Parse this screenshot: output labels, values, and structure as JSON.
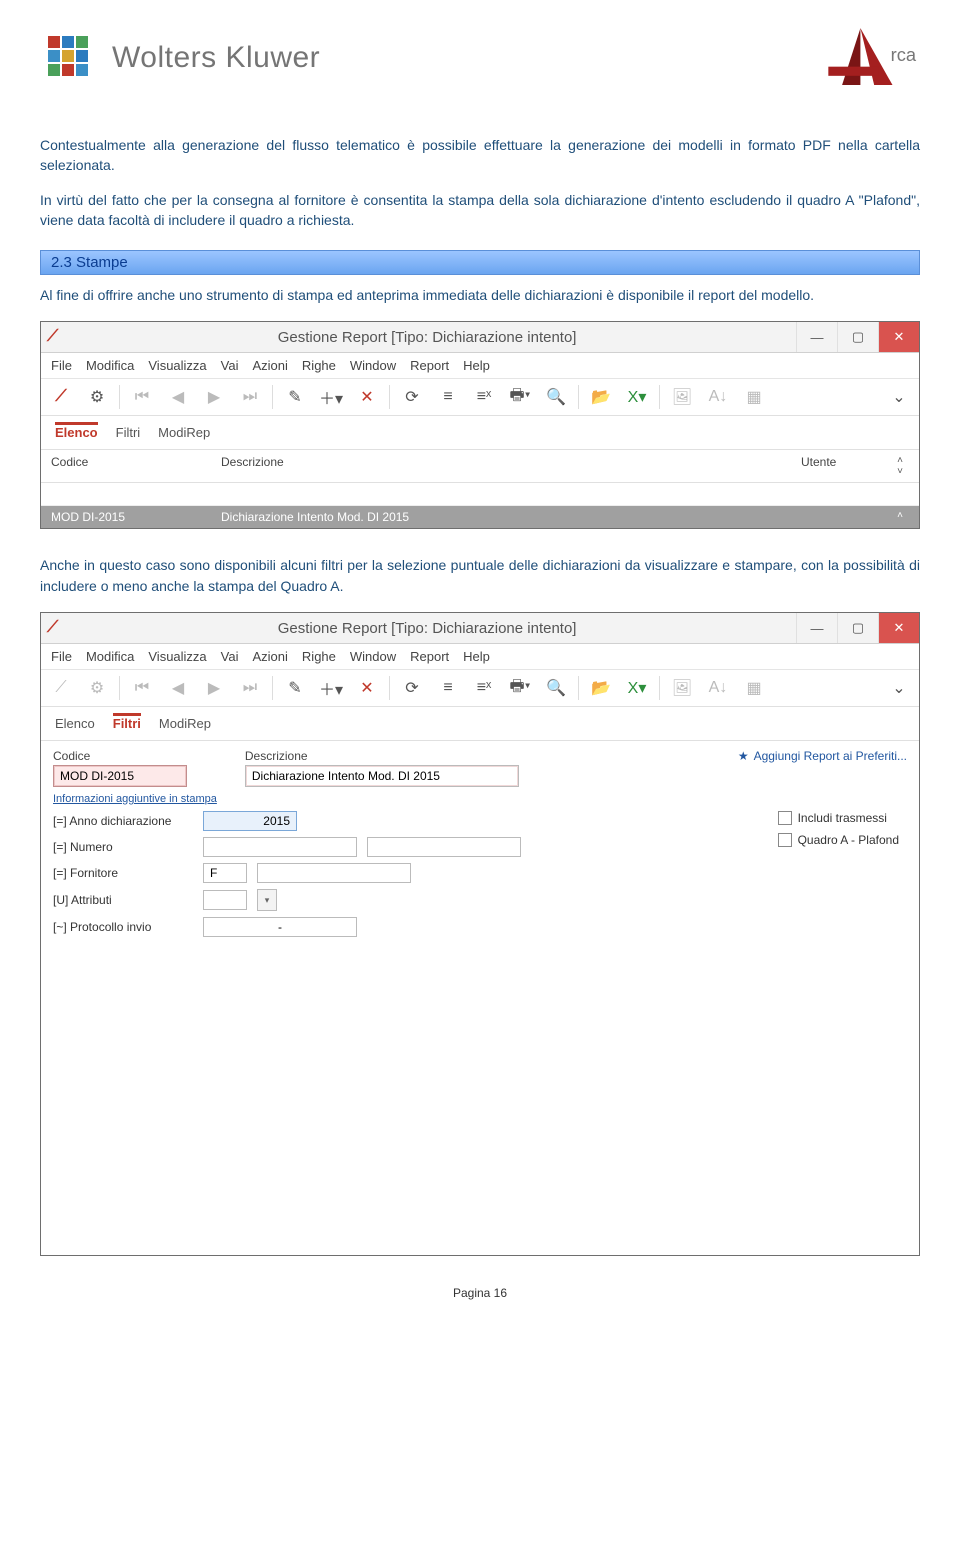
{
  "header": {
    "brand": "Wolters Kluwer",
    "secondary_brand": "rca"
  },
  "paragraphs": {
    "p1": "Contestualmente alla generazione del flusso telematico è possibile effettuare la generazione dei modelli in formato PDF nella cartella selezionata.",
    "p2": "In virtù del fatto che per la consegna al fornitore è consentita la stampa della sola dichiarazione d'intento escludendo il quadro A \"Plafond\", viene data facoltà di includere il quadro a richiesta.",
    "section_heading": "2.3   Stampe",
    "p3": "Al fine di offrire anche uno strumento di stampa ed anteprima immediata delle dichiarazioni è disponibile il report del modello.",
    "p4": "Anche in questo caso sono disponibili alcuni filtri per la selezione puntuale delle dichiarazioni da visualizzare e stampare, con la possibilità di includere o meno anche la stampa del Quadro A."
  },
  "window1": {
    "title": "Gestione Report [Tipo: Dichiarazione intento]",
    "menu": [
      "File",
      "Modifica",
      "Visualizza",
      "Vai",
      "Azioni",
      "Righe",
      "Window",
      "Report",
      "Help"
    ],
    "tabs": [
      "Elenco",
      "Filtri",
      "ModiRep"
    ],
    "active_tab": 0,
    "columns": {
      "codice": "Codice",
      "descrizione": "Descrizione",
      "utente": "Utente"
    },
    "row": {
      "codice": "MOD DI-2015",
      "descrizione": "Dichiarazione Intento Mod. DI 2015"
    }
  },
  "window2": {
    "title": "Gestione Report [Tipo: Dichiarazione intento]",
    "menu": [
      "File",
      "Modifica",
      "Visualizza",
      "Vai",
      "Azioni",
      "Righe",
      "Window",
      "Report",
      "Help"
    ],
    "tabs": [
      "Elenco",
      "Filtri",
      "ModiRep"
    ],
    "active_tab": 1,
    "fields": {
      "codice_label": "Codice",
      "codice_value": "MOD DI-2015",
      "descrizione_label": "Descrizione",
      "descrizione_value": "Dichiarazione Intento Mod. DI 2015",
      "info_link": "Informazioni aggiuntive in stampa",
      "fav_link": "Aggiungi Report ai Preferiti..."
    },
    "criteria": {
      "anno": {
        "label": "[=] Anno dichiarazione",
        "value": "2015"
      },
      "numero": {
        "label": "[=] Numero",
        "value": ""
      },
      "fornitore": {
        "label": "[=] Fornitore",
        "value": "F"
      },
      "attributi": {
        "label": "[U] Attributi",
        "value": ""
      },
      "protocollo": {
        "label": "[~] Protocollo invio",
        "value": "-"
      }
    },
    "checkboxes": {
      "includi": "Includi trasmessi",
      "quadroA": "Quadro A - Plafond"
    }
  },
  "footer": "Pagina 16"
}
